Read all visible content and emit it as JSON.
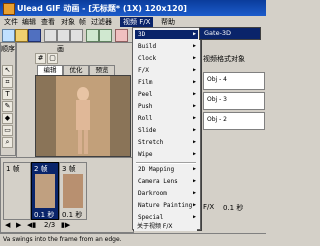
{
  "window": {
    "title": "Ulead GIF 动画 - [无标题* (1X) 120x120]"
  },
  "menubar": [
    "文件",
    "编辑",
    "查看",
    "对象",
    "帧",
    "过滤器",
    "视频 F/X",
    "帮助"
  ],
  "panels": {
    "left_panel_title": "画",
    "sequence_label": "顺序",
    "tabs": [
      "编辑",
      "优化",
      "预览"
    ],
    "frames": [
      "1 帧",
      "2 帧",
      "3 帧"
    ],
    "frame_delays": [
      "0.1 秒",
      "0.1 秒"
    ],
    "page_indicator": "2/3",
    "right_header_btn": "Gate-3D",
    "right_label": "视频格式对象",
    "obj_items": [
      "Obj - 4",
      "Obj - 3",
      "Obj - 2"
    ],
    "right_tag": "F/X",
    "right_value": "0.1 秒"
  },
  "video_fx_menu": {
    "items": [
      "3D",
      "Build",
      "Clock",
      "F/X",
      "Film",
      "Peel",
      "Push",
      "Roll",
      "Slide",
      "Stretch",
      "Wipe"
    ],
    "items2": [
      "2D Mapping",
      "Camera Lens",
      "Darkroom",
      "Nature Painting",
      "Special"
    ],
    "about": "关于视频 F/X",
    "submenu_item": "Gate-3D"
  },
  "statusbar": {
    "text": "Va swings into the frame from an edge."
  }
}
